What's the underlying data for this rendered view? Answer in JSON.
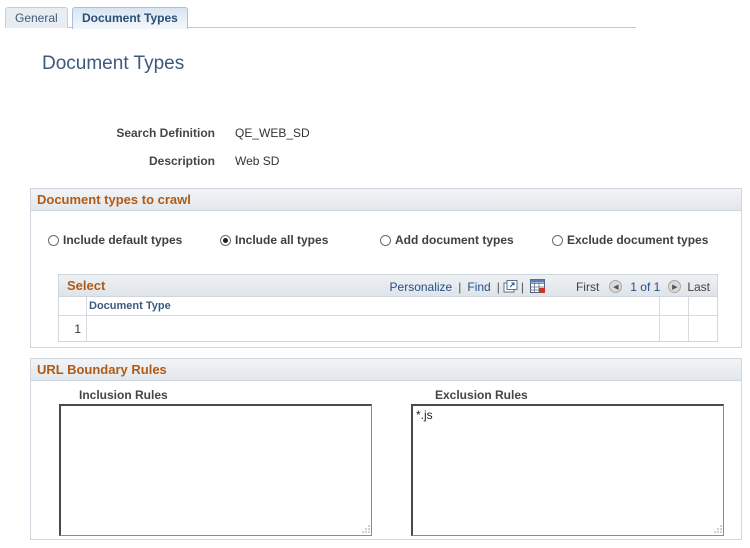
{
  "tabs": {
    "general": "General",
    "document_types": "Document Types"
  },
  "page_title": "Document Types",
  "fields": {
    "search_definition_label": "Search Definition",
    "search_definition_value": "QE_WEB_SD",
    "description_label": "Description",
    "description_value": "Web SD"
  },
  "crawl": {
    "title": "Document types to crawl",
    "options": {
      "default": "Include default types",
      "all": "Include all types",
      "add": "Add document types",
      "exclude": "Exclude document types"
    },
    "selected": "all"
  },
  "grid": {
    "title": "Select",
    "personalize": "Personalize",
    "find": "Find",
    "first": "First",
    "range": "1 of 1",
    "last": "Last",
    "column": "Document Type",
    "rows": [
      "1"
    ]
  },
  "url_rules": {
    "title": "URL Boundary Rules",
    "inclusion_label": "Inclusion Rules",
    "inclusion_value": "",
    "exclusion_label": "Exclusion Rules",
    "exclusion_value": "*.js"
  }
}
